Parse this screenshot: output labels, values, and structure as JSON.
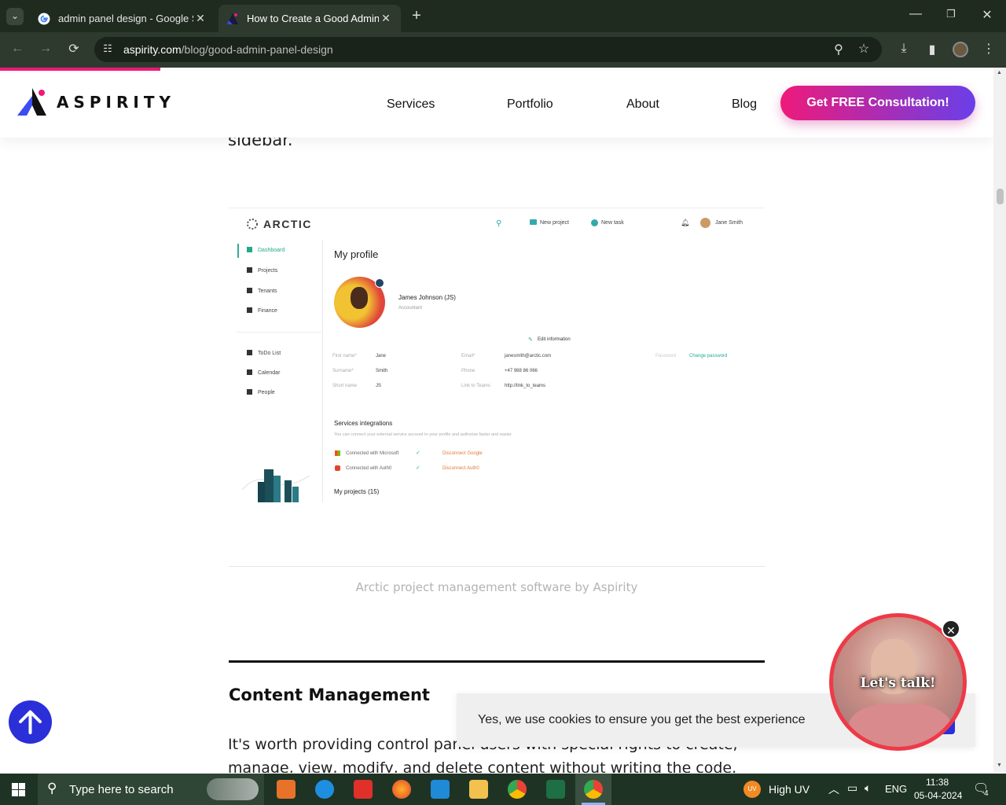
{
  "browser": {
    "tabs": [
      {
        "title": "admin panel design - Google Se",
        "active": false
      },
      {
        "title": "How to Create a Good Admin P",
        "active": true
      }
    ],
    "url_domain": "aspirity.com",
    "url_path": "/blog/good-admin-panel-design"
  },
  "site": {
    "logo": "ASPIRITY",
    "nav": [
      "Services",
      "Portfolio",
      "About",
      "Blog"
    ],
    "cta": "Get FREE Consultation!",
    "accent_pink": "#ee1a7a",
    "accent_blue": "#2b2fd8"
  },
  "article": {
    "fragment_top": "sidebar.",
    "figure": {
      "brand": "ARCTIC",
      "top_actions": [
        "New project",
        "New task"
      ],
      "user": "Jane Smith",
      "menu_primary": [
        "Dashboard",
        "Projects",
        "Tenants",
        "Finance"
      ],
      "menu_secondary": [
        "ToDo List",
        "Calendar",
        "People"
      ],
      "heading": "My profile",
      "profile_name": "James Johnson (JS)",
      "profile_role": "Accountant",
      "edit_link": "Edit information",
      "fields": [
        {
          "label": "First name*",
          "value": "Jane"
        },
        {
          "label": "Surname*",
          "value": "Smith"
        },
        {
          "label": "Short name",
          "value": "JS"
        }
      ],
      "fields2": [
        {
          "label": "Email*",
          "value": "janesmith@arctic.com"
        },
        {
          "label": "Phone",
          "value": "+47 988 86 066"
        },
        {
          "label": "Link to Teams",
          "value": "http://link_to_teams"
        }
      ],
      "password_label": "Password",
      "password_link": "Change password",
      "integrations_title": "Services integrations",
      "integrations_desc": "You can connect your external service account to your profile and authorize faster and easier.",
      "integrations": [
        {
          "name": "Connected with Microsoft",
          "action": "Disconnect Google"
        },
        {
          "name": "Connected with Auth0",
          "action": "Disconnect Auth0"
        }
      ],
      "projects": "My projects (15)"
    },
    "caption": "Arctic project management software by Aspirity",
    "section_title": "Content Management",
    "body": "It's worth providing control panel users with special rights to create, manage, view, modify, and delete content without writing the code."
  },
  "cookie_text": "Yes, we use cookies to ensure you get the best experience",
  "talk_label": "Let's talk!",
  "taskbar": {
    "search_placeholder": "Type here to search",
    "weather": "High UV",
    "weather_badge": "UV",
    "lang": "ENG",
    "time": "11:38",
    "date": "05-04-2024",
    "notifications": "4"
  }
}
